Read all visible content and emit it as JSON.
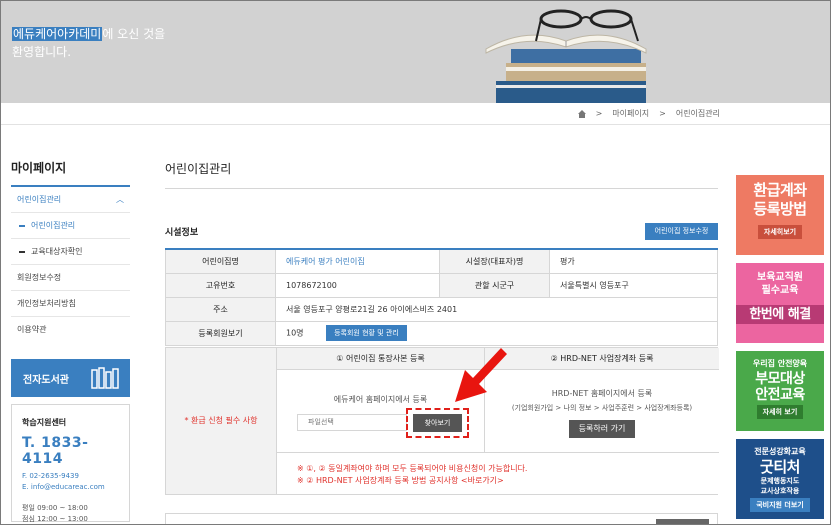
{
  "hero": {
    "welcome_highlight": "에듀케어아카데미",
    "welcome_rest": "에 오신 것을",
    "welcome_line2": "환영합니다."
  },
  "breadcrumb": [
    "마이페이지",
    "어린이집관리"
  ],
  "sidebar": {
    "title": "마이페이지",
    "items": [
      {
        "label": "어린이집관리"
      },
      {
        "label": "어린이집관리"
      },
      {
        "label": "교육대상자확인"
      },
      {
        "label": "회원정보수정"
      },
      {
        "label": "개인정보처리방침"
      },
      {
        "label": "이용약관"
      }
    ],
    "ebook_label": "전자도서관"
  },
  "support": {
    "title": "학습지원센터",
    "phone": "T. 1833-4114",
    "fax": "F. 02-2635-9439",
    "email": "E. info@educareac.com",
    "weekday": "평일    09:00 ~ 18:00",
    "lunch": "점심    12:00 ~ 13:00"
  },
  "main": {
    "page_title": "어린이집관리",
    "section_title": "시설정보",
    "edit_button": "어린이집 정보수정"
  },
  "facility": {
    "name_label": "어린이집명",
    "name_value": "에듀케어 평가 어린이집",
    "director_label": "시설장(대표자)명",
    "director_value": "평가",
    "id_label": "고유번호",
    "id_value": "1078672100",
    "region_label": "관할 시군구",
    "region_value": "서울특별시 영등포구",
    "address_label": "주소",
    "address_value": "서울 영등포구 양평로21길 26 아이에스비즈 2401",
    "members_label": "등록회원보기",
    "members_value": "10명",
    "members_button": "등록회원 현황 및 관리"
  },
  "register": {
    "side_label": "* 환급 신청 필수 사항",
    "col1_title": "① 어린이집 통장사본 등록",
    "col2_title": "② HRD-NET 사업장계좌 등록",
    "col1_hint": "에듀케어 홈페이지에서 등록",
    "file_placeholder": "파일선택",
    "find_button": "찾아보기",
    "col2_hint": "HRD-NET 홈페이지에서 등록",
    "col2_path": "(기업회원가입 > 나의 정보 > 사업주훈련 > 사업장계좌등록)",
    "go_button": "등록하러 가기",
    "note1": "※ ①, ② 동일계좌여야 하며 모두 등록되어야 비용신청이 가능합니다.",
    "note2": "※ ② HRD-NET 사업장계좌 등록 방법 공지사항 <바로가기>"
  },
  "banners": [
    {
      "line1": "환급계좌",
      "line2": "등록방법",
      "button": "자세히보기"
    },
    {
      "line1": "보육교직원",
      "line2": "필수교육",
      "line3": "한번에 해결"
    },
    {
      "line1": "우리집 안전양육",
      "line2": "부모대상",
      "line3": "안전교육",
      "button": "자세히 보기"
    },
    {
      "line1": "전문성강화교육",
      "line2": "굿티처",
      "line3": "문제행동지도",
      "line4": "교사상호작용",
      "button": "국비지원 더보기"
    }
  ],
  "colors": {
    "accent": "#3a7fc0",
    "alert": "#e0312b"
  }
}
